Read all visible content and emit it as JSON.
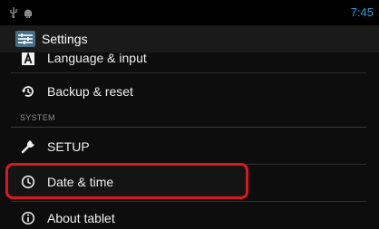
{
  "status_bar": {
    "time": "7:45",
    "accent_color": "#2a9fd6",
    "icons": [
      "usb-icon",
      "android-debug-icon"
    ]
  },
  "action_bar": {
    "title": "Settings",
    "icon": "settings-app-icon"
  },
  "list": {
    "items": [
      {
        "label": "Language & input",
        "icon": "language-a-icon"
      },
      {
        "label": "Backup & reset",
        "icon": "backup-restore-icon"
      }
    ],
    "section_header": "SYSTEM",
    "system_items": [
      {
        "label": "SETUP",
        "icon": "wrench-icon"
      },
      {
        "label": "Date & time",
        "icon": "clock-icon",
        "highlighted": true
      },
      {
        "label": "About tablet",
        "icon": "info-icon"
      }
    ]
  },
  "highlight_color": "#d81921"
}
